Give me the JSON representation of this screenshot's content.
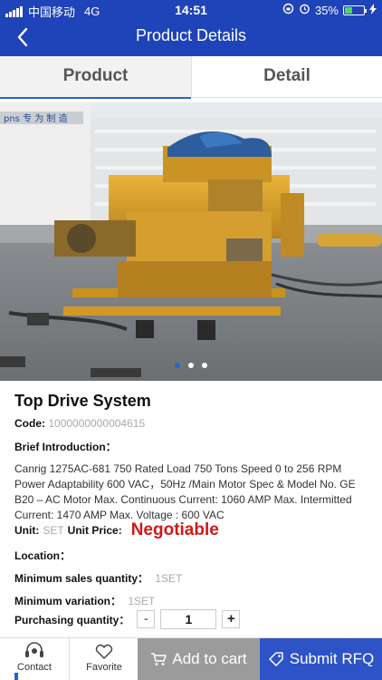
{
  "status_bar": {
    "carrier": "中国移动",
    "network": "4G",
    "time": "14:51",
    "battery_percent": "35%",
    "battery_level": 0.35
  },
  "nav": {
    "title": "Product Details",
    "back_icon": "chevron-left-icon"
  },
  "tabs": [
    {
      "label": "Product",
      "active": true
    },
    {
      "label": "Detail",
      "active": false
    }
  ],
  "carousel": {
    "sign_text": "pns 专 为 制 造",
    "slide_count": 3,
    "active_slide": 1
  },
  "product": {
    "title": "Top Drive System",
    "code_label": "Code:",
    "code_value": "1000000000004615",
    "brief_label": "Brief Introduction：",
    "brief_text": "Canrig 1275AC-681 750  Rated Load 750 Tons  Speed 0 to 256 RPM Power Adaptability 600 VAC，50Hz  /Main Motor Spec & Model No. GE B20 – AC Motor Max. Continuous Current: 1060 AMP Max. Intermitted Current: 1470 AMP Max. Voltage : 600 VAC",
    "unit_label": "Unit:",
    "unit_value": "SET",
    "unit_price_label": "Unit Price:",
    "unit_price_value": "Negotiable",
    "location_label": "Location：",
    "min_sales_label": "Minimum sales quantity：",
    "min_sales_value": "1SET",
    "min_variation_label": "Minimum variation：",
    "min_variation_value": "1SET",
    "purchasing_label": "Purchasing quantity：",
    "quantity": "1",
    "minus": "-",
    "plus": "+"
  },
  "bottom_bar": {
    "contact_label": "Contact",
    "favorite_label": "Favorite",
    "add_to_cart_label": "Add to cart",
    "submit_rfq_label": "Submit RFQ"
  },
  "colors": {
    "brand_blue": "#1f43b8",
    "negotiable_red": "#d01818",
    "cart_gray": "#9b9b9b",
    "rfq_blue": "#2e53c6"
  }
}
